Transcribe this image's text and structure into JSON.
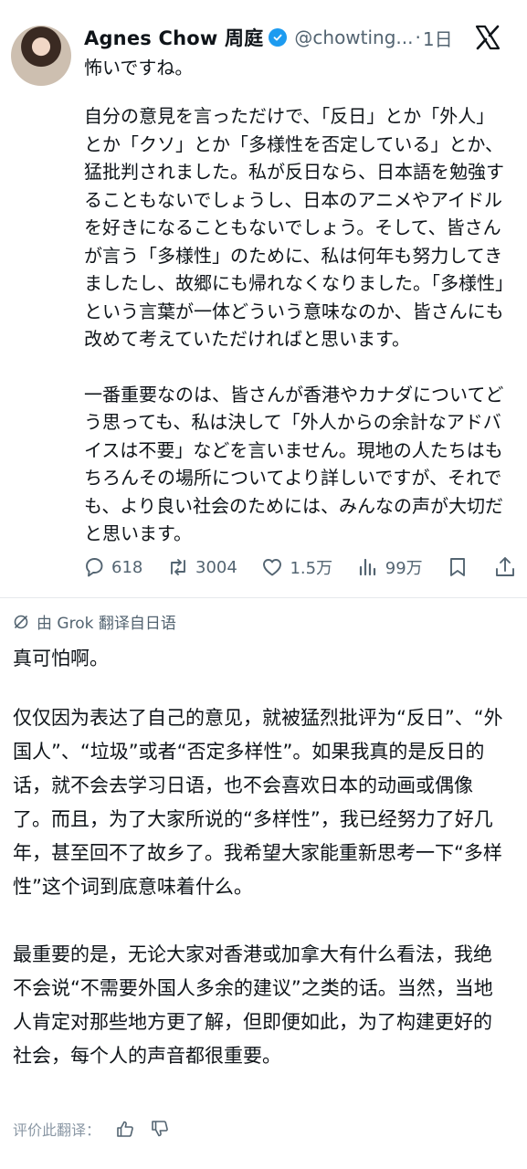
{
  "tweet": {
    "author_name": "Agnes Chow 周庭",
    "handle": "@chowting...",
    "separator": "·",
    "time": "1日",
    "first_line": "怖いですね。",
    "paragraphs": [
      "自分の意見を言っただけで、「反日」とか「外人」とか「クソ」とか「多様性を否定している」とか、猛批判されました。私が反日なら、日本語を勉強することもないでしょうし、日本のアニメやアイドルを好きになることもないでしょう。そして、皆さんが言う「多様性」のために、私は何年も努力してきましたし、故郷にも帰れなくなりました。「多様性」という言葉が一体どういう意味なのか、皆さんにも改めて考えていただければと思います。",
      "一番重要なのは、皆さんが香港やカナダについてどう思っても、私は決して「外人からの余計なアドバイスは不要」などを言いません。現地の人たちはもちろんその場所についてより詳しいですが、それでも、より良い社会のためには、みんなの声が大切だと思います。"
    ],
    "stats": {
      "replies": "618",
      "reposts": "3004",
      "likes": "1.5万",
      "views": "99万"
    }
  },
  "translation": {
    "label": "由 Grok 翻译自日语",
    "first_line": "真可怕啊。",
    "paragraphs": [
      "仅仅因为表达了自己的意见，就被猛烈批评为“反日”、“外国人”、“垃圾”或者“否定多样性”。如果我真的是反日的话，就不会去学习日语，也不会喜欢日本的动画或偶像了。而且，为了大家所说的“多样性”，我已经努力了好几年，甚至回不了故乡了。我希望大家能重新思考一下“多样性”这个词到底意味着什么。",
      "最重要的是，无论大家对香港或加拿大有什么看法，我绝不会说“不需要外国人多余的建议”之类的话。当然，当地人肯定对那些地方更了解，但即便如此，为了构建更好的社会，每个人的声音都很重要。"
    ],
    "rate_label": "评价此翻译："
  },
  "icons": {
    "verified": "verified-badge-icon",
    "x_logo": "x-logo-icon",
    "reply": "reply-icon",
    "repost": "repost-icon",
    "like": "heart-icon",
    "views": "views-chart-icon",
    "bookmark": "bookmark-icon",
    "share": "share-icon",
    "grok": "grok-icon",
    "thumbs_up": "thumbs-up-icon",
    "thumbs_down": "thumbs-down-icon"
  },
  "colors": {
    "text": "#0f1419",
    "secondary": "#536471",
    "verified": "#1d9bf0"
  }
}
